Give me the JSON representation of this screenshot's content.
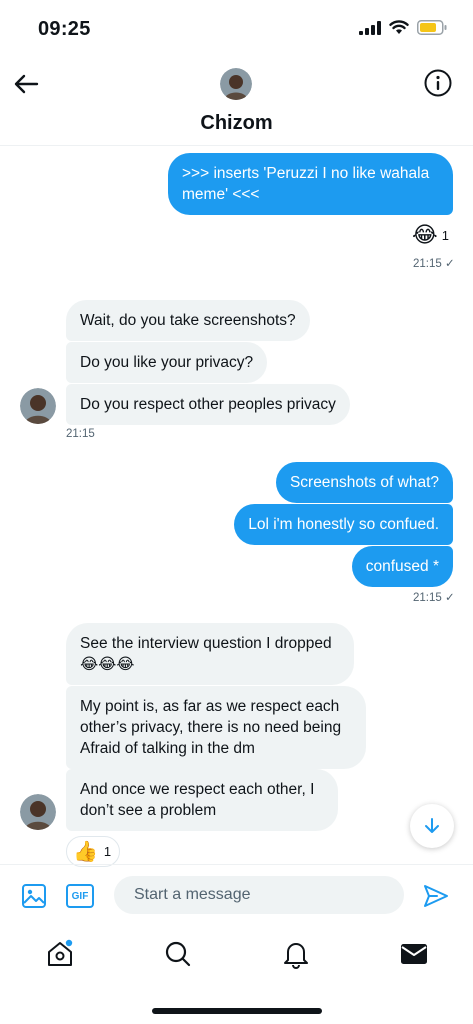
{
  "status": {
    "time": "09:25"
  },
  "header": {
    "contact_name": "Chizom"
  },
  "messages": {
    "out1": {
      "text": ">>> inserts 'Peruzzi I no like wahala meme' <<<",
      "reaction_count": "1",
      "time": "21:15 ✓"
    },
    "in1": [
      {
        "text": "Wait, do you take screenshots?"
      },
      {
        "text": "Do you like your privacy?"
      },
      {
        "text": "Do you respect other peoples privacy"
      }
    ],
    "in1_time": "21:15",
    "out2": [
      {
        "text": "Screenshots of what?"
      },
      {
        "text": "Lol i'm honestly so confued."
      },
      {
        "text": "confused *"
      }
    ],
    "out2_time": "21:15 ✓",
    "in2": [
      {
        "text": "See the interview question I dropped 😂😂😂"
      },
      {
        "text": "My point is, as far as we respect each other’s privacy, there is no need being Afraid of talking in the dm"
      },
      {
        "text": "And once we respect each other, I don’t see a problem"
      }
    ],
    "in2_reaction_count": "1"
  },
  "composer": {
    "placeholder": "Start a message",
    "gif_label": "GIF"
  },
  "colors": {
    "accent": "#1d9bf0",
    "bubble_in": "#eff3f4",
    "text": "#0f1419",
    "muted": "#536471"
  }
}
